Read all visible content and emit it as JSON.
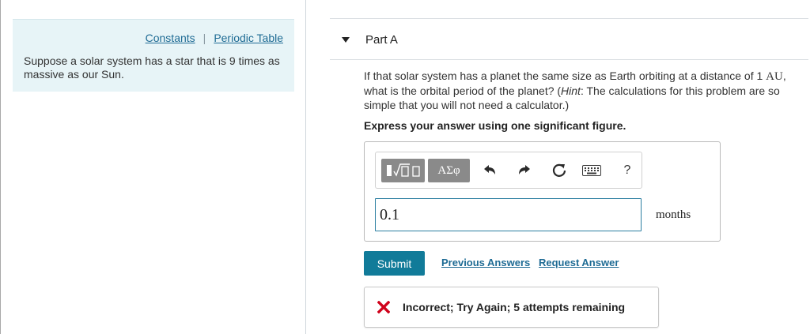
{
  "intro": {
    "links": [
      "Constants",
      "Periodic Table"
    ],
    "separator": "|",
    "text": "Suppose a solar system has a star that is 9 times as massive as our Sun."
  },
  "part": {
    "title": "Part A",
    "question_pre": "If that solar system has a planet the same size as Earth orbiting at a distance of 1 ",
    "question_unit": "AU",
    "question_mid": ", what is the orbital period of the planet? (",
    "hint_label": "Hint",
    "question_post": ": The calculations for this problem are so simple that you will not need a calculator.)",
    "instruction": "Express your answer using one significant figure."
  },
  "toolbar": {
    "symbols_label": "ΑΣφ",
    "help_label": "?",
    "icons": [
      "templates-icon",
      "undo-icon",
      "redo-icon",
      "reset-icon",
      "keyboard-icon",
      "help-icon"
    ]
  },
  "answer": {
    "value": "0.1",
    "units": "months"
  },
  "actions": {
    "submit_label": "Submit",
    "previous_answers_label": "Previous Answers",
    "request_answer_label": "Request Answer"
  },
  "feedback": {
    "text": "Incorrect; Try Again; 5 attempts remaining",
    "icon": "x-icon"
  },
  "colors": {
    "info_bg": "#e7f4f7",
    "link": "#1e6b94",
    "submit_bg": "#117b99",
    "error_red": "#d0021b"
  }
}
